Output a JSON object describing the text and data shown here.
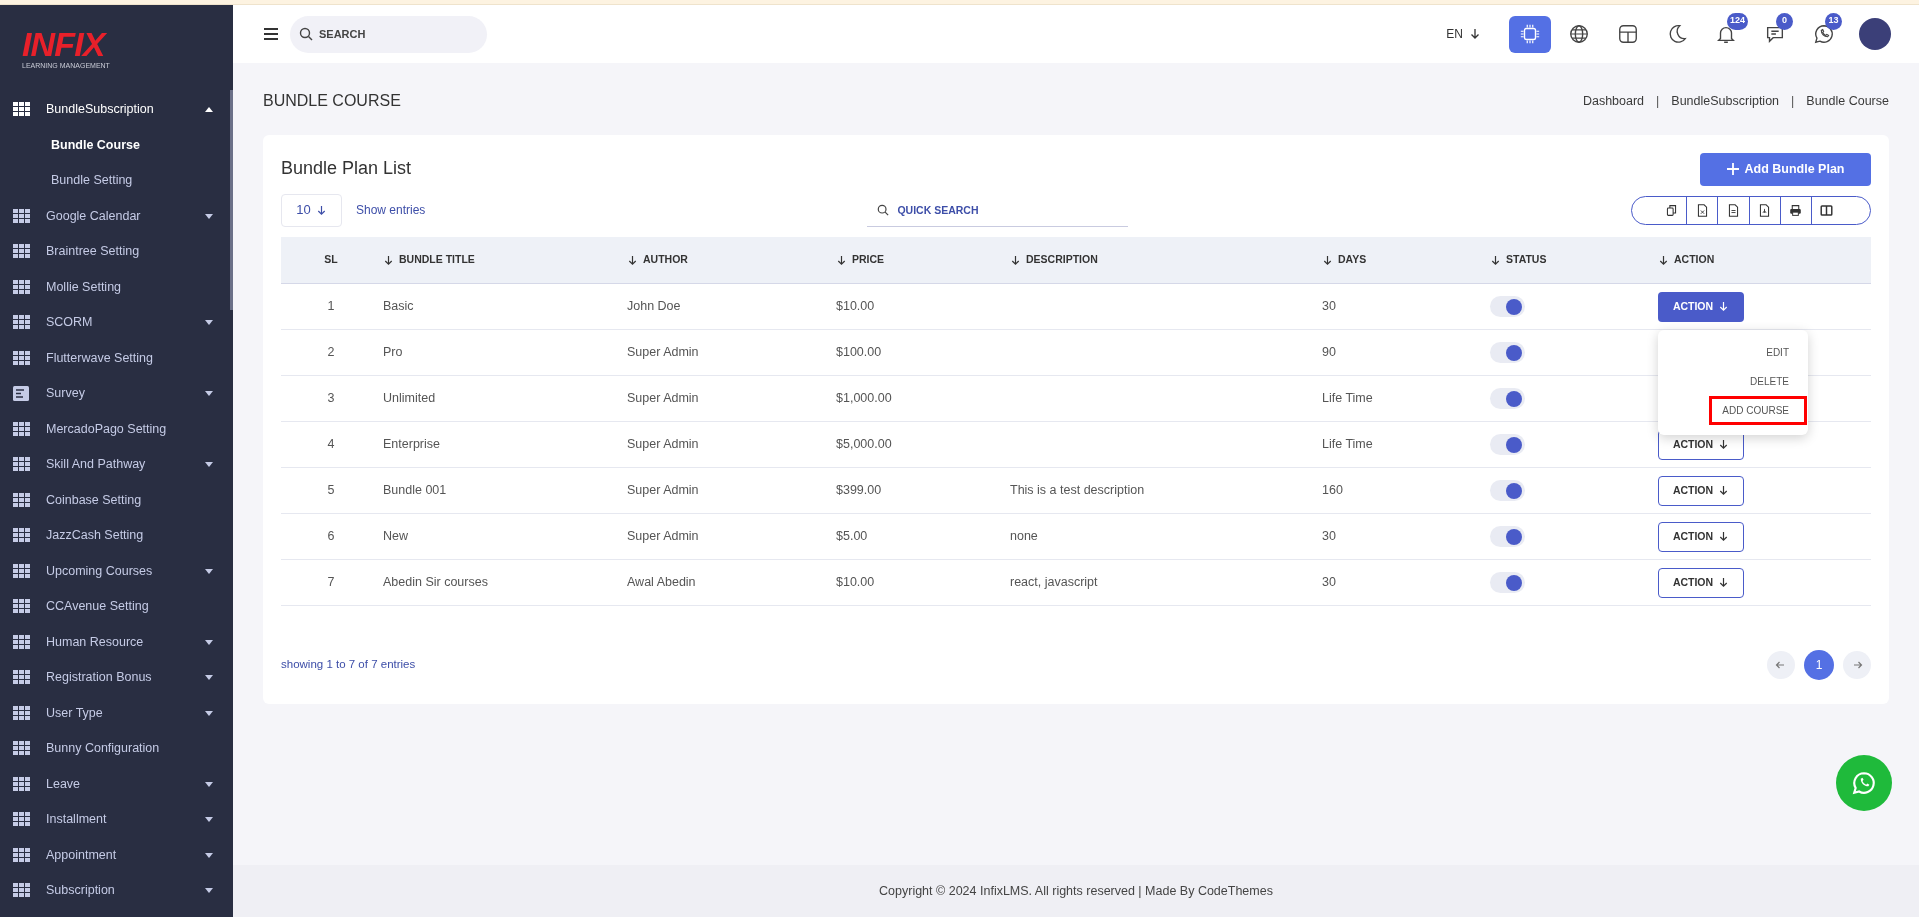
{
  "sidebar": {
    "logo": {
      "title": "INFIX",
      "subtitle": "LEARNING MANAGEMENT"
    },
    "items": [
      {
        "label": "BundleSubscription",
        "kind": "group",
        "expanded": true,
        "children": [
          {
            "label": "Bundle Course",
            "selected": true
          },
          {
            "label": "Bundle Setting",
            "selected": false
          }
        ]
      },
      {
        "label": "Google Calendar",
        "kind": "group",
        "expanded": false
      },
      {
        "label": "Braintree Setting",
        "kind": "link"
      },
      {
        "label": "Mollie Setting",
        "kind": "link"
      },
      {
        "label": "SCORM",
        "kind": "group",
        "expanded": false
      },
      {
        "label": "Flutterwave Setting",
        "kind": "link"
      },
      {
        "label": "Survey",
        "kind": "form_group",
        "expanded": false
      },
      {
        "label": "MercadoPago Setting",
        "kind": "link"
      },
      {
        "label": "Skill And Pathway",
        "kind": "group",
        "expanded": false
      },
      {
        "label": "Coinbase Setting",
        "kind": "link"
      },
      {
        "label": "JazzCash Setting",
        "kind": "link"
      },
      {
        "label": "Upcoming Courses",
        "kind": "group",
        "expanded": false
      },
      {
        "label": "CCAvenue Setting",
        "kind": "link"
      },
      {
        "label": "Human Resource",
        "kind": "group",
        "expanded": false
      },
      {
        "label": "Registration Bonus",
        "kind": "group",
        "expanded": false
      },
      {
        "label": "User Type",
        "kind": "group",
        "expanded": false
      },
      {
        "label": "Bunny Configuration",
        "kind": "link"
      },
      {
        "label": "Leave",
        "kind": "group",
        "expanded": false
      },
      {
        "label": "Installment",
        "kind": "group",
        "expanded": false
      },
      {
        "label": "Appointment",
        "kind": "group",
        "expanded": false
      },
      {
        "label": "Subscription",
        "kind": "group",
        "expanded": false
      }
    ]
  },
  "top_bar": {
    "search": {
      "placeholder": "SEARCH"
    },
    "language": "EN",
    "buttons": [
      {
        "kind": "ai",
        "selected": true
      },
      {
        "kind": "globe",
        "selected": false
      },
      {
        "kind": "layout",
        "selected": false
      },
      {
        "kind": "moon",
        "selected": false
      },
      {
        "kind": "bell",
        "selected": false,
        "badge": "124"
      },
      {
        "kind": "chat",
        "selected": false,
        "badge": "0"
      },
      {
        "kind": "whatsapp",
        "selected": false,
        "badge": "13"
      }
    ]
  },
  "page": {
    "title": "BUNDLE COURSE",
    "breadcrumbs": [
      {
        "kind": "link",
        "text": "Dashboard"
      },
      {
        "kind": "separator",
        "text": "|"
      },
      {
        "kind": "link",
        "text": "BundleSubscription"
      },
      {
        "kind": "separator",
        "text": "|"
      },
      {
        "kind": "link",
        "text": "Bundle Course"
      }
    ]
  },
  "card": {
    "title": "Bundle Plan List",
    "add_button": "Add Bundle Plan",
    "page_size": "10",
    "show_entries": "Show entries",
    "quick_search": {
      "placeholder": "QUICK SEARCH"
    },
    "export_buttons": [
      {
        "kind": "copy"
      },
      {
        "kind": "excel"
      },
      {
        "kind": "csv"
      },
      {
        "kind": "pdf"
      },
      {
        "kind": "print"
      },
      {
        "kind": "columns"
      }
    ],
    "table": {
      "columns": [
        {
          "label": "SL",
          "sortable": false
        },
        {
          "label": "BUNDLE TITLE",
          "sortable": true
        },
        {
          "label": "AUTHOR",
          "sortable": true
        },
        {
          "label": "PRICE",
          "sortable": true
        },
        {
          "label": "DESCRIPTION",
          "sortable": true
        },
        {
          "label": "DAYS",
          "sortable": true
        },
        {
          "label": "STATUS",
          "sortable": true
        },
        {
          "label": "ACTION",
          "sortable": true
        }
      ],
      "rows": [
        {
          "sl": "1",
          "title": "Basic",
          "author": "John Doe",
          "price": "$10.00",
          "days": "30",
          "status_on": true,
          "action": {
            "label": "ACTION",
            "open": true,
            "menu": [
              {
                "label": "EDIT",
                "highlighted": false
              },
              {
                "label": "DELETE",
                "highlighted": false
              },
              {
                "label": "ADD COURSE",
                "highlighted": true
              }
            ]
          }
        },
        {
          "sl": "2",
          "title": "Pro",
          "author": "Super Admin",
          "price": "$100.00",
          "days": "90",
          "status_on": true
        },
        {
          "sl": "3",
          "title": "Unlimited",
          "author": "Super Admin",
          "price": "$1,000.00",
          "days": "Life Time",
          "status_on": true
        },
        {
          "sl": "4",
          "title": "Enterprise",
          "author": "Super Admin",
          "price": "$5,000.00",
          "days": "Life Time",
          "status_on": true,
          "action": {
            "label": "ACTION",
            "open": false
          }
        },
        {
          "sl": "5",
          "title": "Bundle 001",
          "author": "Super Admin",
          "price": "$399.00",
          "description": "This is a test description",
          "days": "160",
          "status_on": true,
          "action": {
            "label": "ACTION",
            "open": false
          }
        },
        {
          "sl": "6",
          "title": "New",
          "author": "Super Admin",
          "price": "$5.00",
          "description": "none",
          "days": "30",
          "status_on": true,
          "action": {
            "label": "ACTION",
            "open": false
          }
        },
        {
          "sl": "7",
          "title": "Abedin Sir courses",
          "author": "Awal Abedin",
          "price": "$10.00",
          "description": "react, javascript",
          "days": "30",
          "status_on": true,
          "action": {
            "label": "ACTION",
            "open": false
          }
        }
      ]
    },
    "summary": "showing 1 to 7 of 7 entries",
    "pagination": [
      {
        "label": "1",
        "selected": true
      }
    ]
  },
  "footer": "Copyright © 2024 InfixLMS. All rights reserved | Made By CodeThemes"
}
